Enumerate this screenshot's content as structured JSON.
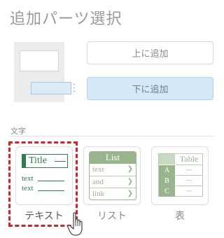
{
  "panel": {
    "title": "追加パーツ選択"
  },
  "placement": {
    "above_label": "上に追加",
    "below_label": "下に追加"
  },
  "section": {
    "label": "文字"
  },
  "parts": [
    {
      "label": "テキスト",
      "selected": true,
      "thumb": {
        "title": "Title",
        "lines": [
          "text",
          "text"
        ]
      }
    },
    {
      "label": "リスト",
      "thumb": {
        "header": "List",
        "items": [
          "text",
          "and",
          "link"
        ]
      }
    },
    {
      "label": "表",
      "thumb": {
        "header": "Table",
        "rows": [
          "A",
          "B",
          "C"
        ],
        "cell": "—"
      }
    }
  ],
  "colors": {
    "selection": "#c9272d",
    "accent_green": "#2e7d4f",
    "muted_green": "#9ab58e",
    "button_active": "#d6e7f7"
  },
  "icons": {
    "cursor": "hand-pointer-icon"
  }
}
